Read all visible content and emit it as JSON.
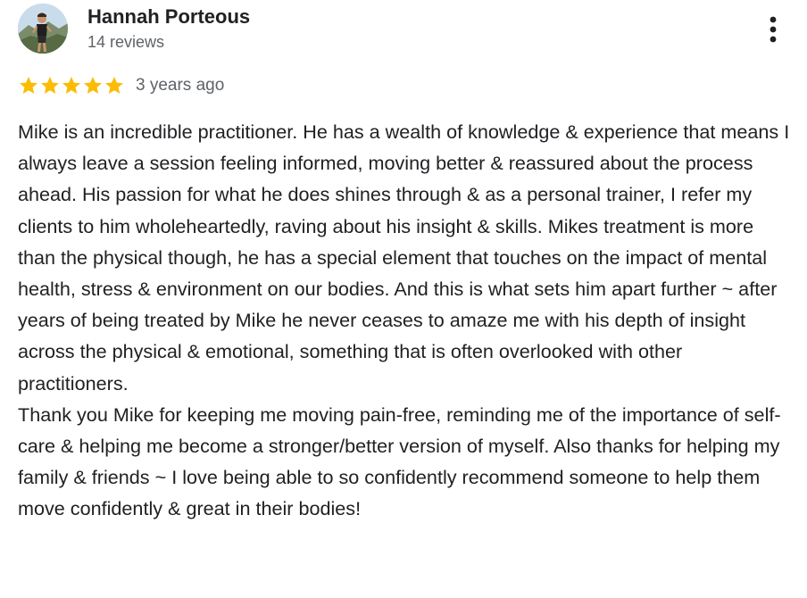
{
  "reviewer": {
    "name": "Hannah Porteous",
    "review_count": "14 reviews",
    "avatar_icon": "profile-photo"
  },
  "menu": {
    "icon": "more-vertical-icon"
  },
  "rating": {
    "stars": 5,
    "max_stars": 5,
    "star_color": "#fbbc04",
    "date": "3 years ago"
  },
  "review": {
    "paragraph_1": "Mike is an incredible practitioner. He has a wealth of knowledge & experience that means I always leave a session feeling informed, moving better & reassured about the process ahead. His passion for what he does shines through & as a personal trainer, I refer my clients to him wholeheartedly, raving about his insight & skills. Mikes treatment is more than the physical though, he has a special element that touches on the impact of mental health, stress & environment on our bodies. And this is what sets him apart further ~ after years of being treated by Mike he never ceases to amaze me with his depth of insight across the physical & emotional, something that is often overlooked with other practitioners.",
    "paragraph_2": "Thank you Mike for keeping me moving pain-free, reminding me of the importance of self-care & helping me become a stronger/better version of myself. Also thanks for helping my family & friends ~ I love being able to so confidently recommend someone to help them move confidently & great in their bodies!"
  },
  "colors": {
    "text_primary": "#202124",
    "text_secondary": "#5f6368",
    "star": "#fbbc04"
  }
}
